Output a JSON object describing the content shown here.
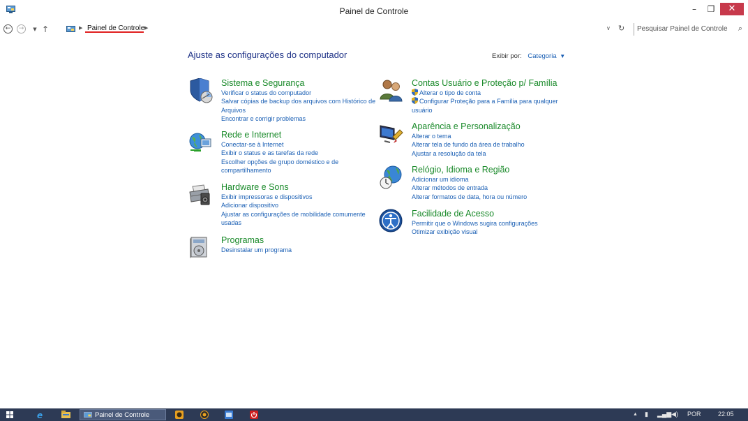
{
  "window": {
    "title": "Painel de Controle",
    "controls": {
      "minimize": "–",
      "restore": "❐",
      "close": "✕"
    }
  },
  "address_bar": {
    "breadcrumb": "Painel de Controle",
    "search_placeholder": "Pesquisar Painel de Controle"
  },
  "main": {
    "heading": "Ajuste as configurações do computador",
    "view_by_label": "Exibir por:",
    "view_by_value": "Categoria",
    "categories": [
      {
        "title": "Sistema e Segurança",
        "icon": "shield-icon",
        "links": [
          "Verificar o status do computador",
          "Salvar cópias de backup dos arquivos com Histórico de Arquivos",
          "Encontrar e corrigir problemas"
        ]
      },
      {
        "title": "Rede e Internet",
        "icon": "network-globe-icon",
        "links": [
          "Conectar-se à Internet",
          "Exibir o status e as tarefas da rede",
          "Escolher opções de grupo doméstico e de compartilhamento"
        ]
      },
      {
        "title": "Hardware e Sons",
        "icon": "printer-speaker-icon",
        "links": [
          "Exibir impressoras e dispositivos",
          "Adicionar dispositivo",
          "Ajustar as configurações de mobilidade comumente usadas"
        ]
      },
      {
        "title": "Programas",
        "icon": "programs-icon",
        "links": [
          "Desinstalar um programa"
        ]
      },
      {
        "title": "Contas Usuário e Proteção p/ Família",
        "icon": "users-icon",
        "links": [
          "Alterar o tipo de conta",
          "Configurar Proteção para a Família para qualquer usuário"
        ]
      },
      {
        "title": "Aparência e Personalização",
        "icon": "appearance-icon",
        "links": [
          "Alterar o tema",
          "Alterar tela de fundo da área de trabalho",
          "Ajustar a resolução da tela"
        ]
      },
      {
        "title": "Relógio, Idioma e Região",
        "icon": "clock-globe-icon",
        "links": [
          "Adicionar um idioma",
          "Alterar métodos de entrada",
          "Alterar formatos de data, hora ou número"
        ]
      },
      {
        "title": "Facilidade de Acesso",
        "icon": "ease-of-access-icon",
        "links": [
          "Permitir que o Windows sugira configurações",
          "Otimizar exibição visual"
        ]
      }
    ]
  },
  "taskbar": {
    "active_window": "Painel de Controle",
    "language": "POR",
    "time": "22:05"
  }
}
